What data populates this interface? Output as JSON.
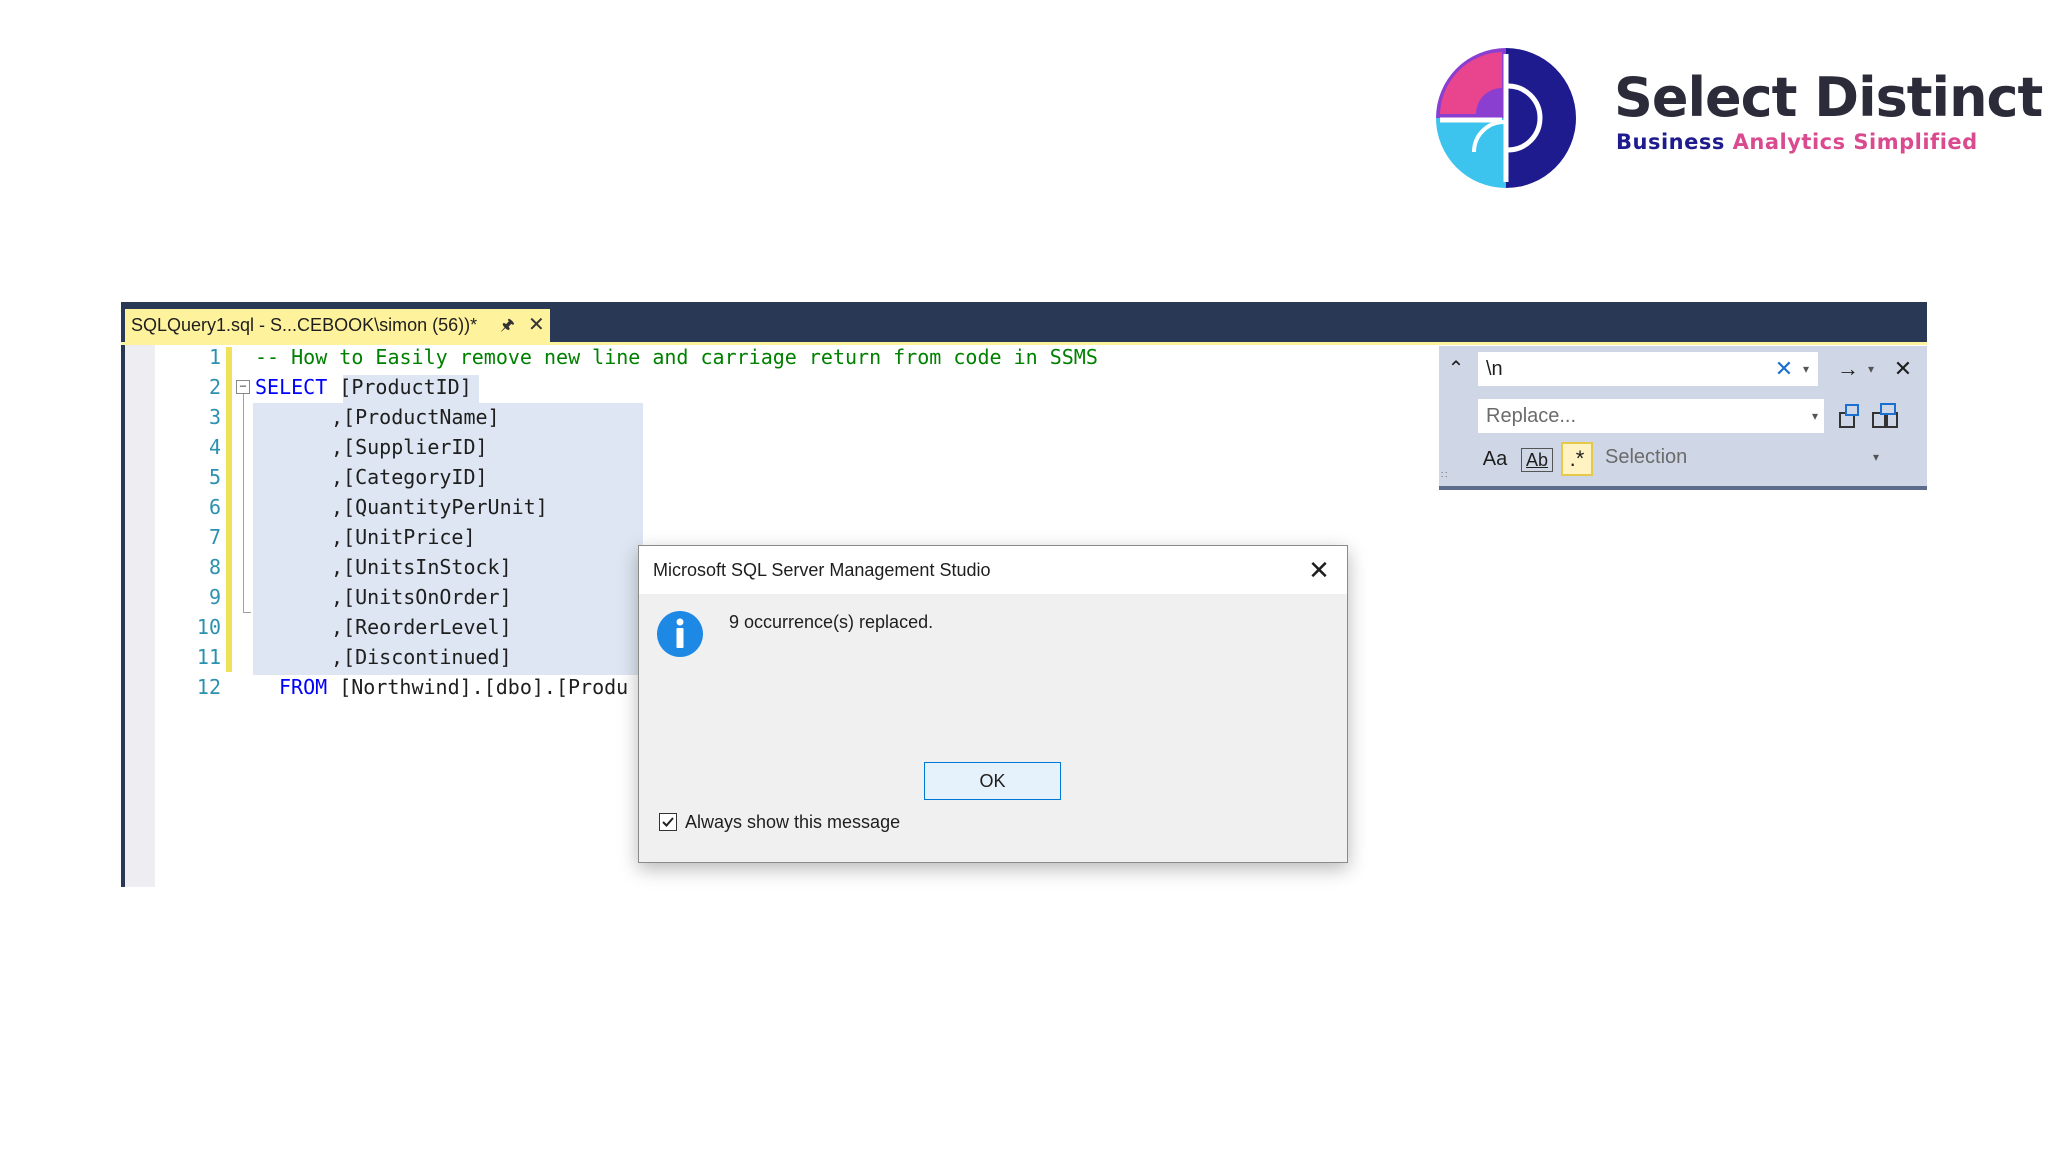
{
  "brand": {
    "name": "Select Distinct",
    "tagline_part1": "Business",
    "tagline_part2": "Analytics Simplified",
    "colors": {
      "pink": "#e8458e",
      "purple": "#8a3fd0",
      "navy": "#1e1b8f",
      "cyan": "#3cc4ee"
    }
  },
  "editor": {
    "tab_title": "SQLQuery1.sql - S...CEBOOK\\simon (56))*",
    "tab_pin_icon": "pin-icon",
    "tab_close_icon": "close-icon",
    "line_numbers": [
      "1",
      "2",
      "3",
      "4",
      "5",
      "6",
      "7",
      "8",
      "9",
      "10",
      "11",
      "12"
    ],
    "lines": {
      "l1": "-- How to Easily remove new line and carriage return from code in SSMS",
      "l2_kw": "SELECT",
      "l2_rest": "[ProductID]",
      "l3": ",[ProductName]",
      "l4": ",[SupplierID]",
      "l5": ",[CategoryID]",
      "l6": ",[QuantityPerUnit]",
      "l7": ",[UnitPrice]",
      "l8": ",[UnitsInStock]",
      "l9": ",[UnitsOnOrder]",
      "l10": ",[ReorderLevel]",
      "l11": ",[Discontinued]",
      "l12_kw": "FROM",
      "l12_rest": "[Northwind].[dbo].[Produ"
    },
    "colors": {
      "tab_bar": "#293955",
      "tab_active": "#fff29d",
      "keyword": "#0000ff",
      "comment": "#008000",
      "line_number": "#2b91af"
    }
  },
  "find_replace": {
    "search_value": "\\n",
    "replace_placeholder": "Replace...",
    "scope_label": "Selection",
    "icons": [
      "chevron-up-icon",
      "clear-icon",
      "dropdown-icon",
      "find-next-icon",
      "close-icon",
      "replace-next-icon",
      "replace-all-icon",
      "match-case-icon",
      "whole-word-icon",
      "regex-icon"
    ],
    "match_case_label": "Aa",
    "whole_word_label": "Ab"
  },
  "dialog": {
    "title": "Microsoft SQL Server Management Studio",
    "message": "9 occurrence(s) replaced.",
    "ok_label": "OK",
    "checkbox_label": "Always show this message",
    "checkbox_checked": true
  }
}
